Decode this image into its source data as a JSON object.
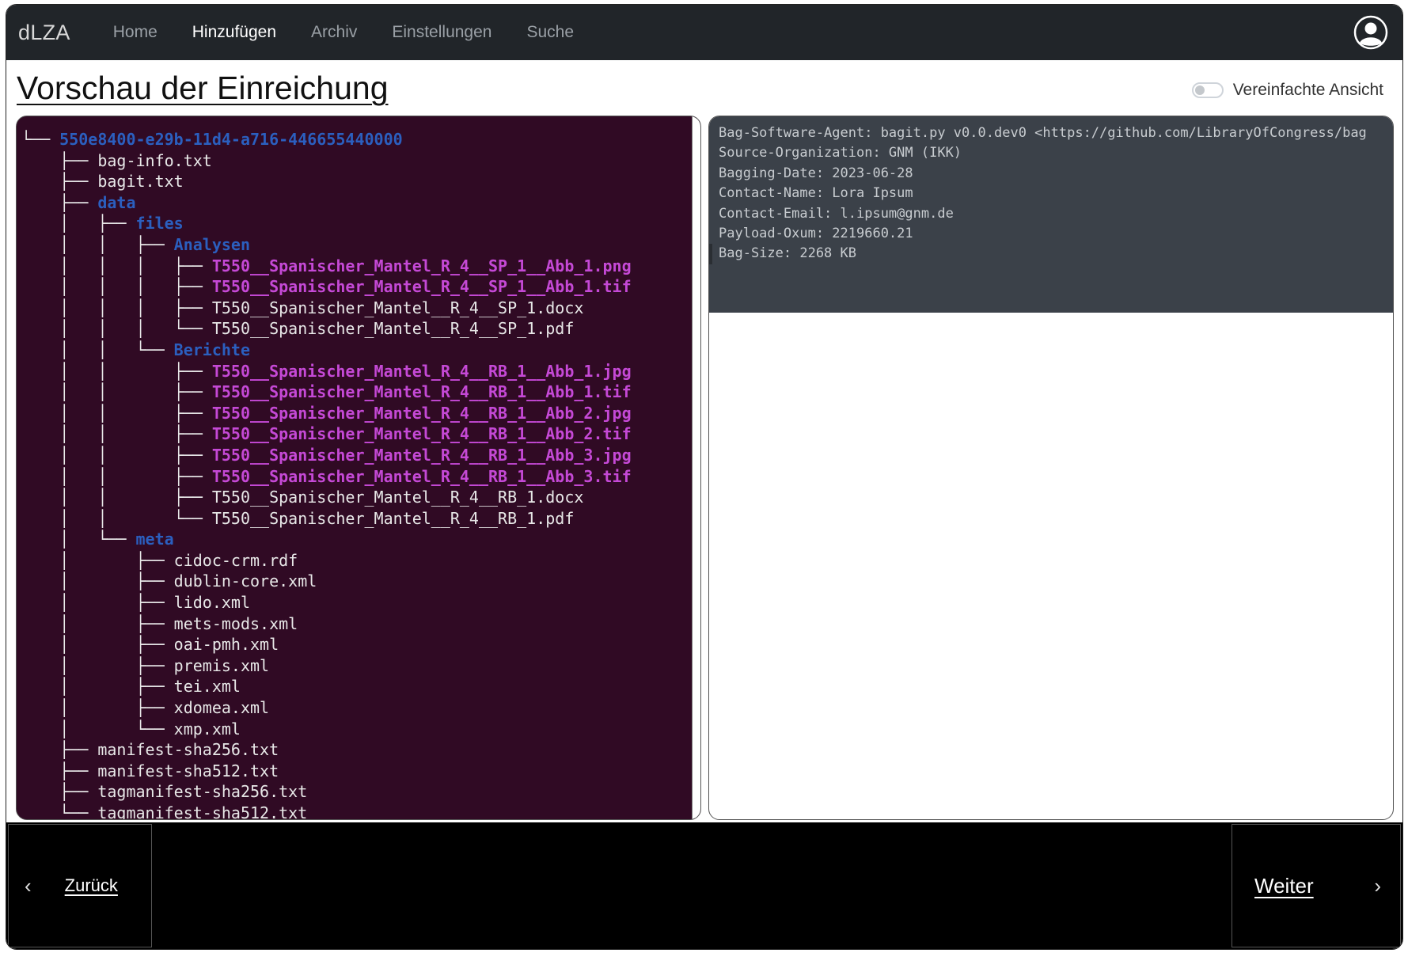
{
  "navbar": {
    "brand": "dLZA",
    "links": [
      {
        "label": "Home",
        "active": false
      },
      {
        "label": "Hinzufügen",
        "active": true
      },
      {
        "label": "Archiv",
        "active": false
      },
      {
        "label": "Einstellungen",
        "active": false
      },
      {
        "label": "Suche",
        "active": false
      }
    ],
    "user_icon": "user-circle-icon"
  },
  "page": {
    "title": "Vorschau der Einreichung",
    "toggle_label": "Vereinfachte Ansicht",
    "toggle_on": false
  },
  "tree": {
    "colors": {
      "background": "#300a24",
      "directory": "#2b5fbf",
      "image_file": "#c549d6",
      "file": "#e8e8e8"
    },
    "lines": [
      {
        "prefix": "└── ",
        "name": "550e8400-e29b-11d4-a716-446655440000",
        "kind": "dir"
      },
      {
        "prefix": "    ├── ",
        "name": "bag-info.txt",
        "kind": "file"
      },
      {
        "prefix": "    ├── ",
        "name": "bagit.txt",
        "kind": "file"
      },
      {
        "prefix": "    ├── ",
        "name": "data",
        "kind": "dir"
      },
      {
        "prefix": "    │   ├── ",
        "name": "files",
        "kind": "dir"
      },
      {
        "prefix": "    │   │   ├── ",
        "name": "Analysen",
        "kind": "dir"
      },
      {
        "prefix": "    │   │   │   ├── ",
        "name": "T550__Spanischer_Mantel_R_4__SP_1__Abb_1.png",
        "kind": "img"
      },
      {
        "prefix": "    │   │   │   ├── ",
        "name": "T550__Spanischer_Mantel_R_4__SP_1__Abb_1.tif",
        "kind": "img"
      },
      {
        "prefix": "    │   │   │   ├── ",
        "name": "T550__Spanischer_Mantel__R_4__SP_1.docx",
        "kind": "file"
      },
      {
        "prefix": "    │   │   │   └── ",
        "name": "T550__Spanischer_Mantel__R_4__SP_1.pdf",
        "kind": "file"
      },
      {
        "prefix": "    │   │   └── ",
        "name": "Berichte",
        "kind": "dir"
      },
      {
        "prefix": "    │   │       ├── ",
        "name": "T550__Spanischer_Mantel_R_4__RB_1__Abb_1.jpg",
        "kind": "img"
      },
      {
        "prefix": "    │   │       ├── ",
        "name": "T550__Spanischer_Mantel_R_4__RB_1__Abb_1.tif",
        "kind": "img"
      },
      {
        "prefix": "    │   │       ├── ",
        "name": "T550__Spanischer_Mantel_R_4__RB_1__Abb_2.jpg",
        "kind": "img"
      },
      {
        "prefix": "    │   │       ├── ",
        "name": "T550__Spanischer_Mantel_R_4__RB_1__Abb_2.tif",
        "kind": "img"
      },
      {
        "prefix": "    │   │       ├── ",
        "name": "T550__Spanischer_Mantel_R_4__RB_1__Abb_3.jpg",
        "kind": "img"
      },
      {
        "prefix": "    │   │       ├── ",
        "name": "T550__Spanischer_Mantel_R_4__RB_1__Abb_3.tif",
        "kind": "img"
      },
      {
        "prefix": "    │   │       ├── ",
        "name": "T550__Spanischer_Mantel__R_4__RB_1.docx",
        "kind": "file"
      },
      {
        "prefix": "    │   │       └── ",
        "name": "T550__Spanischer_Mantel__R_4__RB_1.pdf",
        "kind": "file"
      },
      {
        "prefix": "    │   └── ",
        "name": "meta",
        "kind": "dir"
      },
      {
        "prefix": "    │       ├── ",
        "name": "cidoc-crm.rdf",
        "kind": "file"
      },
      {
        "prefix": "    │       ├── ",
        "name": "dublin-core.xml",
        "kind": "file"
      },
      {
        "prefix": "    │       ├── ",
        "name": "lido.xml",
        "kind": "file"
      },
      {
        "prefix": "    │       ├── ",
        "name": "mets-mods.xml",
        "kind": "file"
      },
      {
        "prefix": "    │       ├── ",
        "name": "oai-pmh.xml",
        "kind": "file"
      },
      {
        "prefix": "    │       ├── ",
        "name": "premis.xml",
        "kind": "file"
      },
      {
        "prefix": "    │       ├── ",
        "name": "tei.xml",
        "kind": "file"
      },
      {
        "prefix": "    │       ├── ",
        "name": "xdomea.xml",
        "kind": "file"
      },
      {
        "prefix": "    │       └── ",
        "name": "xmp.xml",
        "kind": "file"
      },
      {
        "prefix": "    ├── ",
        "name": "manifest-sha256.txt",
        "kind": "file"
      },
      {
        "prefix": "    ├── ",
        "name": "manifest-sha512.txt",
        "kind": "file"
      },
      {
        "prefix": "    ├── ",
        "name": "tagmanifest-sha256.txt",
        "kind": "file"
      },
      {
        "prefix": "    └── ",
        "name": "tagmanifest-sha512.txt",
        "kind": "file"
      }
    ]
  },
  "bag_info": {
    "background": "#3b4149",
    "lines": [
      "Bag-Software-Agent: bagit.py v0.0.dev0 <https://github.com/LibraryOfCongress/bag",
      "Source-Organization: GNM (IKK)",
      "Bagging-Date: 2023-06-28",
      "Contact-Name: Lora Ipsum",
      "Contact-Email: l.ipsum@gnm.de",
      "Payload-Oxum: 2219660.21",
      "Bag-Size: 2268 KB"
    ]
  },
  "footer": {
    "back_label": "Zurück",
    "back_icon": "chevron-left-icon",
    "next_label": "Weiter",
    "next_icon": "chevron-right-icon"
  }
}
